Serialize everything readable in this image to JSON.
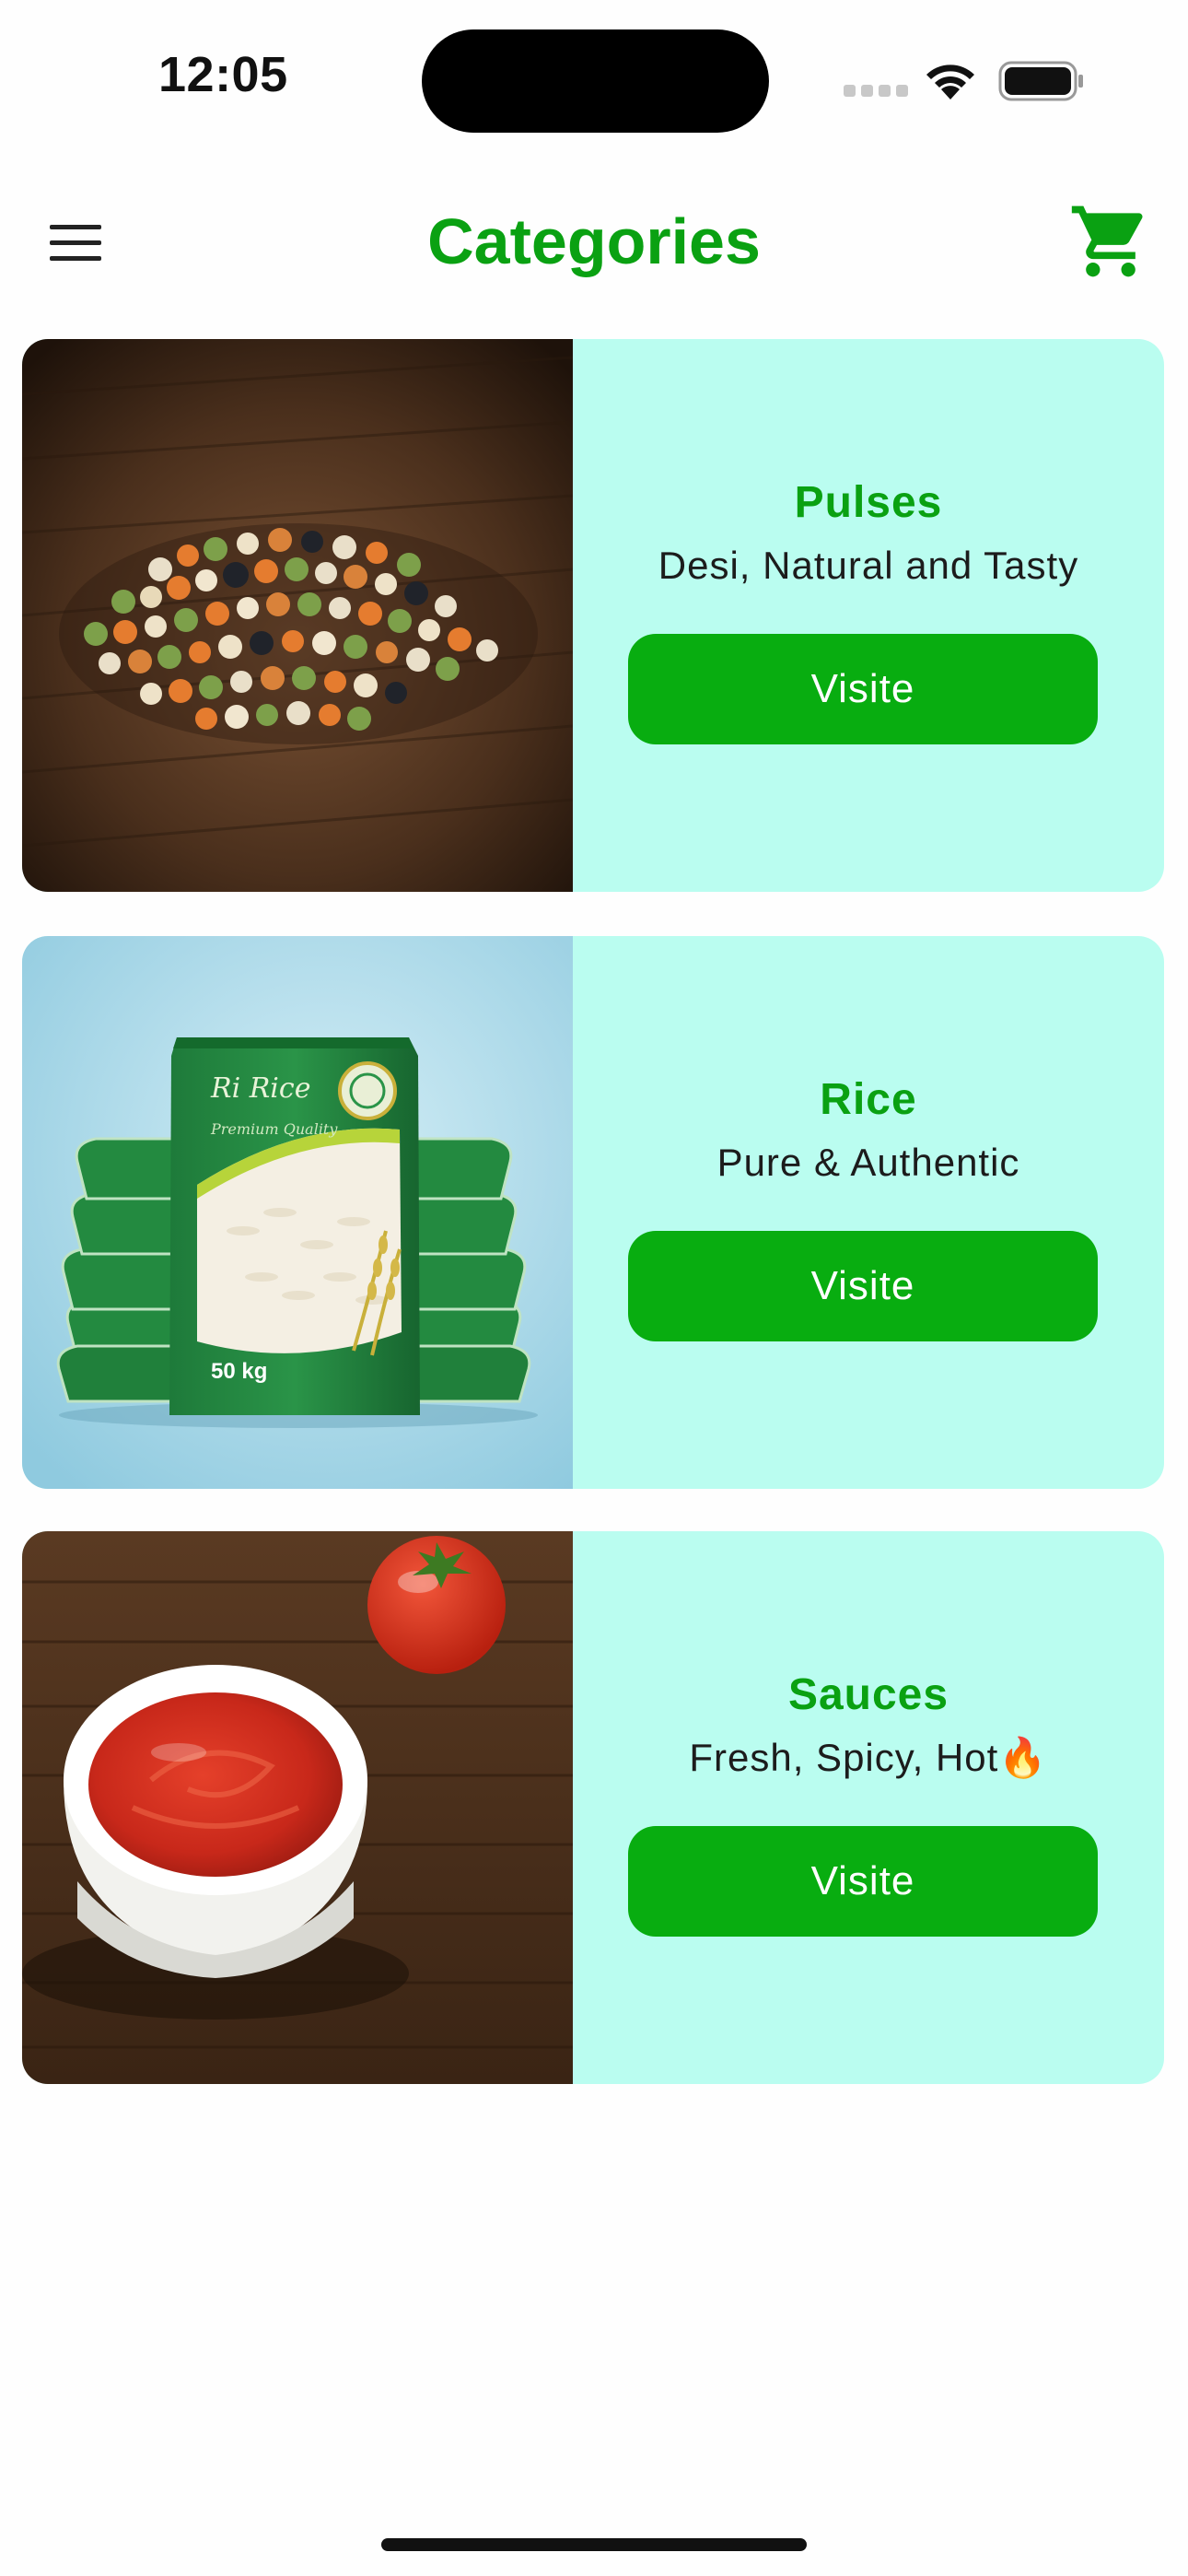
{
  "status_bar": {
    "time": "12:05"
  },
  "header": {
    "title": "Categories",
    "menu_icon": "hamburger-menu-icon",
    "cart_icon": "shopping-cart-icon"
  },
  "colors": {
    "accent": "#0aa112",
    "button": "#08ad10",
    "card_background": "#bafdf0",
    "page_background": "#fefefe"
  },
  "categories": [
    {
      "name": "Pulses",
      "tagline": "Desi, Natural and Tasty",
      "button_label": "Visite"
    },
    {
      "name": "Rice",
      "tagline": "Pure & Authentic",
      "button_label": "Visite"
    },
    {
      "name": "Sauces",
      "tagline": "Fresh, Spicy, Hot🔥",
      "button_label": "Visite"
    }
  ],
  "images": {
    "rice_bag_weight": "50 kg"
  }
}
